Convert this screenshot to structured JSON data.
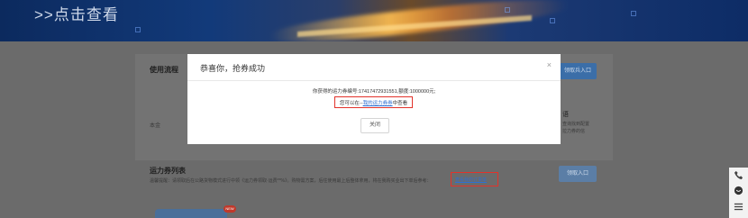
{
  "banner": {
    "title": ">>点击查看"
  },
  "background": {
    "usage_title": "使用流程",
    "usage_button": "领取兵入口",
    "left_text_fragment": "本金",
    "right_heading_fragment": "语",
    "right_lines": [
      "查询找到配置",
      "拉力券的信"
    ],
    "list_title": "运力券列表",
    "list_desc": "温馨提醒：请领取后在公路货物模式进行中领《运力券领取·运费**%》。购物需方案，后往使用最上后整体拿用，将在我购买业出下单后参考：",
    "list_link": "查看我的订货单",
    "list_button": "领取入口",
    "mini_badge": "NEW"
  },
  "modal": {
    "title": "恭喜你，抢券成功",
    "close_symbol": "×",
    "message_line1": "你获得的运力券编号:17417472931551,额度:1000000元;",
    "message_prefix": "您可以在--",
    "message_link": "我的运力券券",
    "message_suffix": "中查看",
    "close_button": "关闭"
  },
  "floatbar": {
    "icons": [
      "phone-icon",
      "chat-icon",
      "list-icon"
    ]
  },
  "colors": {
    "highlight_red": "#e2332b",
    "link_blue": "#2f6fd1",
    "overlay": "#6b6b6b"
  }
}
